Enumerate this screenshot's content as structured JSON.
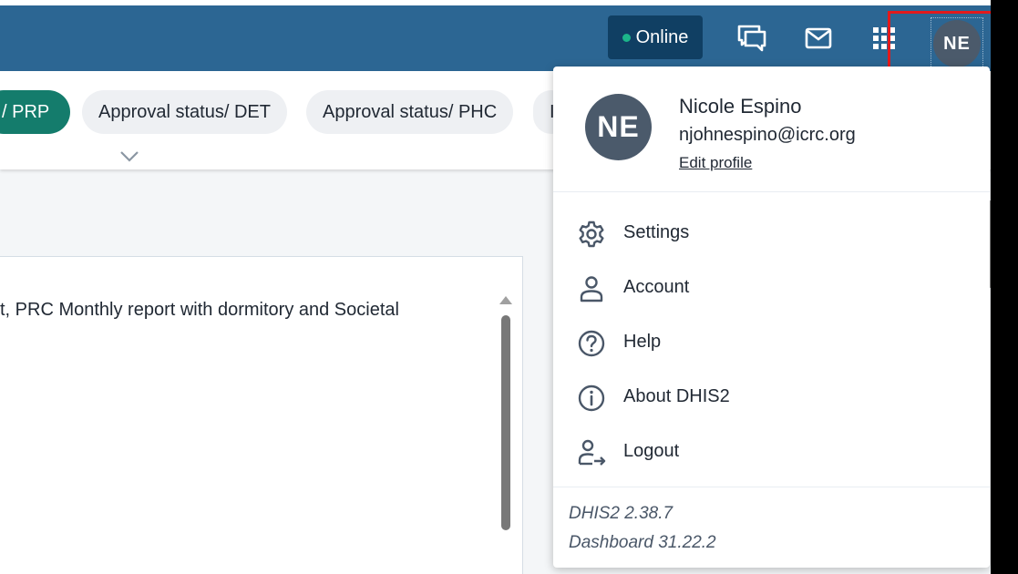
{
  "header": {
    "online_label": "Online",
    "avatar_initials": "NE",
    "colors": {
      "bar": "#2c6693",
      "badge": "#103f63",
      "online_dot": "#1cb58a"
    }
  },
  "filter_chips": [
    {
      "label": "/ PRP",
      "active": true
    },
    {
      "label": "Approval status/ DET",
      "active": false
    },
    {
      "label": "Approval status/ PHC",
      "active": false
    },
    {
      "label": "I",
      "active": false
    }
  ],
  "content": {
    "text": "t, PRC Monthly report with dormitory and Societal"
  },
  "profile_menu": {
    "avatar_initials": "NE",
    "name": "Nicole Espino",
    "email": "njohnespino@icrc.org",
    "edit_profile": "Edit profile",
    "items": [
      {
        "label": "Settings",
        "icon": "gear-icon"
      },
      {
        "label": "Account",
        "icon": "user-icon"
      },
      {
        "label": "Help",
        "icon": "help-icon"
      },
      {
        "label": "About DHIS2",
        "icon": "info-icon"
      },
      {
        "label": "Logout",
        "icon": "logout-icon"
      }
    ],
    "version_dhis2": "DHIS2 2.38.7",
    "version_dashboard": "Dashboard 31.22.2"
  },
  "accent_color": "#147c6c",
  "highlight_color": "#e31a1c"
}
